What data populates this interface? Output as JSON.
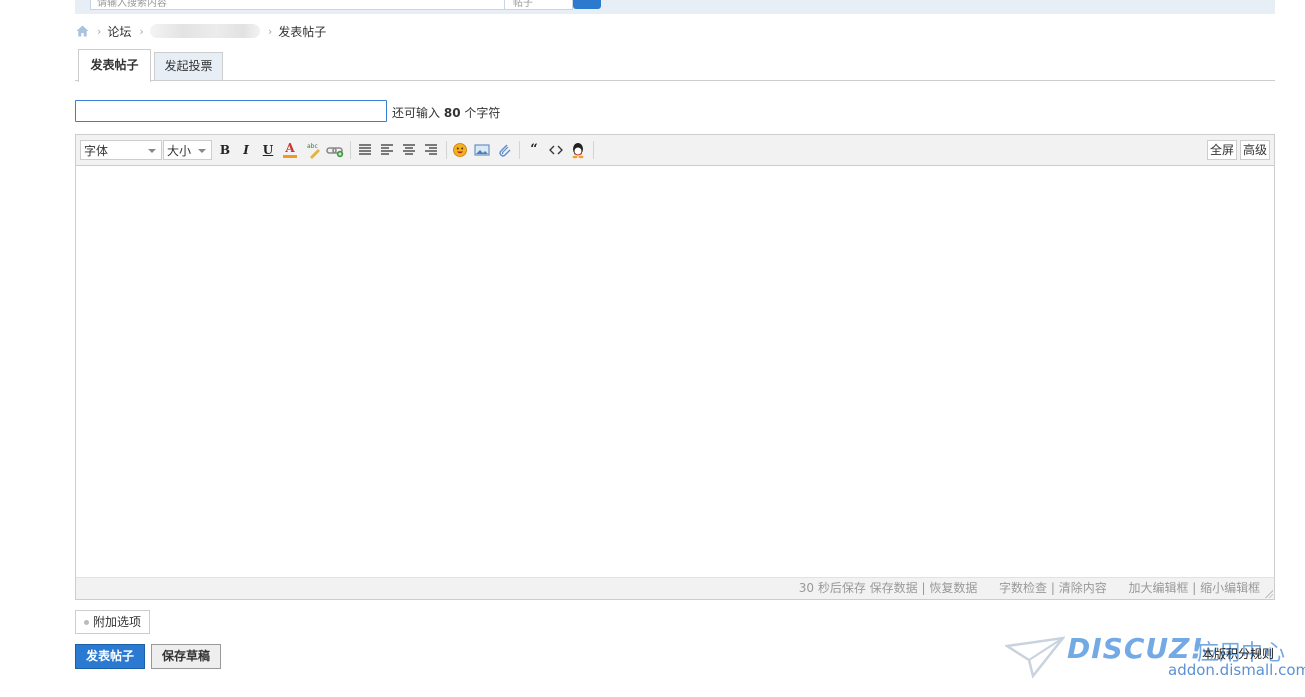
{
  "search": {
    "placeholder": "请输入搜索内容",
    "scope": "帖子"
  },
  "breadcrumb": {
    "forum": "论坛",
    "current": "发表帖子"
  },
  "tabs": {
    "post": "发表帖子",
    "poll": "发起投票"
  },
  "title_field": {
    "value": "",
    "counter_prefix": "还可输入",
    "counter_number": "80",
    "counter_suffix": "个字符"
  },
  "toolbar": {
    "font_select": "字体",
    "size_select": "大小",
    "bold": "B",
    "italic": "I",
    "underline": "U",
    "color": "A",
    "fullscreen": "全屏",
    "advanced": "高级",
    "icons": [
      "bold-icon",
      "italic-icon",
      "underline-icon",
      "font-color-icon",
      "background-color-icon",
      "link-icon",
      "align-justify-icon",
      "align-left-icon",
      "align-center-icon",
      "align-right-icon",
      "smiley-icon",
      "image-icon",
      "attachment-icon",
      "quote-icon",
      "code-icon",
      "qq-icon"
    ]
  },
  "statusbar": {
    "autosave": "30 秒后保存",
    "save_data": "保存数据",
    "restore_data": "恢复数据",
    "word_check": "字数检查",
    "clear": "清除内容",
    "enlarge": "加大编辑框",
    "shrink": "缩小编辑框",
    "sep": "|"
  },
  "extra_options": "附加选项",
  "buttons": {
    "submit": "发表帖子",
    "save_draft": "保存草稿"
  },
  "watermark": {
    "brand": "DISCUZ!",
    "cn": "应用中心",
    "url": "addon.dismall.com",
    "rules_link": "本版积分规则"
  },
  "colors": {
    "accent": "#2a7ad1",
    "tab_bg": "#e8eef6",
    "border": "#cdcdcd"
  }
}
